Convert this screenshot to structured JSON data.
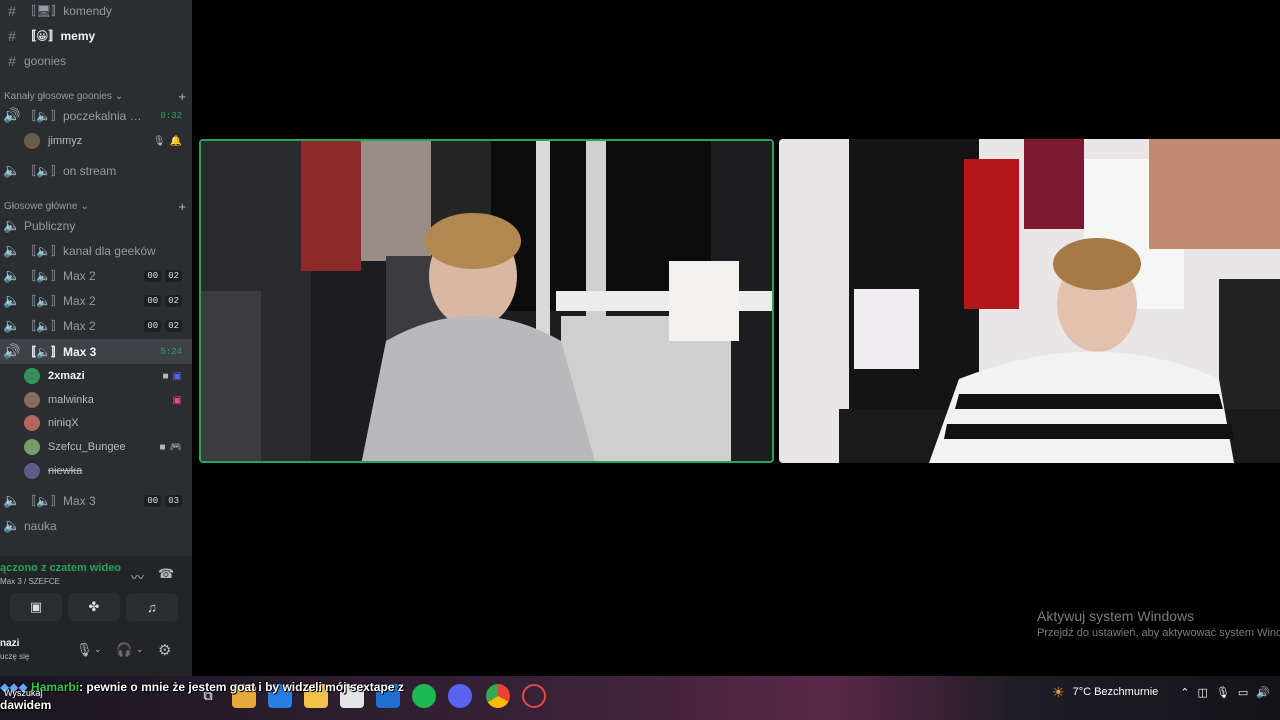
{
  "sidebar": {
    "text_channels": [
      {
        "icon": "hash",
        "label": "〚🖥〛komendy"
      },
      {
        "icon": "hash",
        "label": "〚😀〛memy"
      },
      {
        "icon": "hash",
        "label": "goonies"
      }
    ],
    "category_goonies": "Kanały głosowe goonies",
    "voice_goonies": [
      {
        "label": "〚🔈〛poczekalnia on...",
        "timer": "0:32"
      },
      {
        "label": "〚🔈〛on stream"
      }
    ],
    "jimmyz": "jimmyz",
    "category_main": "Głosowe główne",
    "voice_main": [
      {
        "label": "Publiczny"
      },
      {
        "label": "〚🔈〛kanał dla geeków"
      },
      {
        "label": "〚🔈〛Max 2",
        "a": "00",
        "b": "02"
      },
      {
        "label": "〚🔈〛Max 2",
        "a": "00",
        "b": "02"
      },
      {
        "label": "〚🔈〛Max 2",
        "a": "00",
        "b": "02"
      },
      {
        "label": "〚🔈〛Max 3",
        "timer": "5:24"
      }
    ],
    "max3_users": [
      {
        "name": "2xmazi",
        "color": "#3b8e5a"
      },
      {
        "name": "malwinka",
        "color": "#8a6a5a"
      },
      {
        "name": "niniqX",
        "color": "#b5655f"
      },
      {
        "name": "Szefcu_Bungee",
        "color": "#7b9a6a"
      },
      {
        "name": "niewka",
        "color": "#5b5e8a"
      }
    ],
    "voice_after": [
      {
        "label": "〚🔈〛Max 3",
        "a": "00",
        "b": "03"
      },
      {
        "label": "nauka"
      }
    ]
  },
  "voice_panel": {
    "status": "ączono z czatem wideo",
    "sub": "Max 3 / SZEFCE",
    "me_name": "nazi",
    "me_status": "uczę się"
  },
  "watermark": {
    "title": "Aktywuj system Windows",
    "sub": "Przejdź do ustawień, aby aktywować system Wind"
  },
  "chat": {
    "user": "Hamarbi",
    "message": ": pewnie o mnie że jestem goat i by widzeli mój sextape z",
    "message2": "dawidem",
    "search": "Wyszukaj"
  },
  "tray": {
    "weather": "7°C  Bezchmurnie"
  },
  "colors": {
    "sidebar": "#2b2d31",
    "accent_green": "#23a55a"
  }
}
